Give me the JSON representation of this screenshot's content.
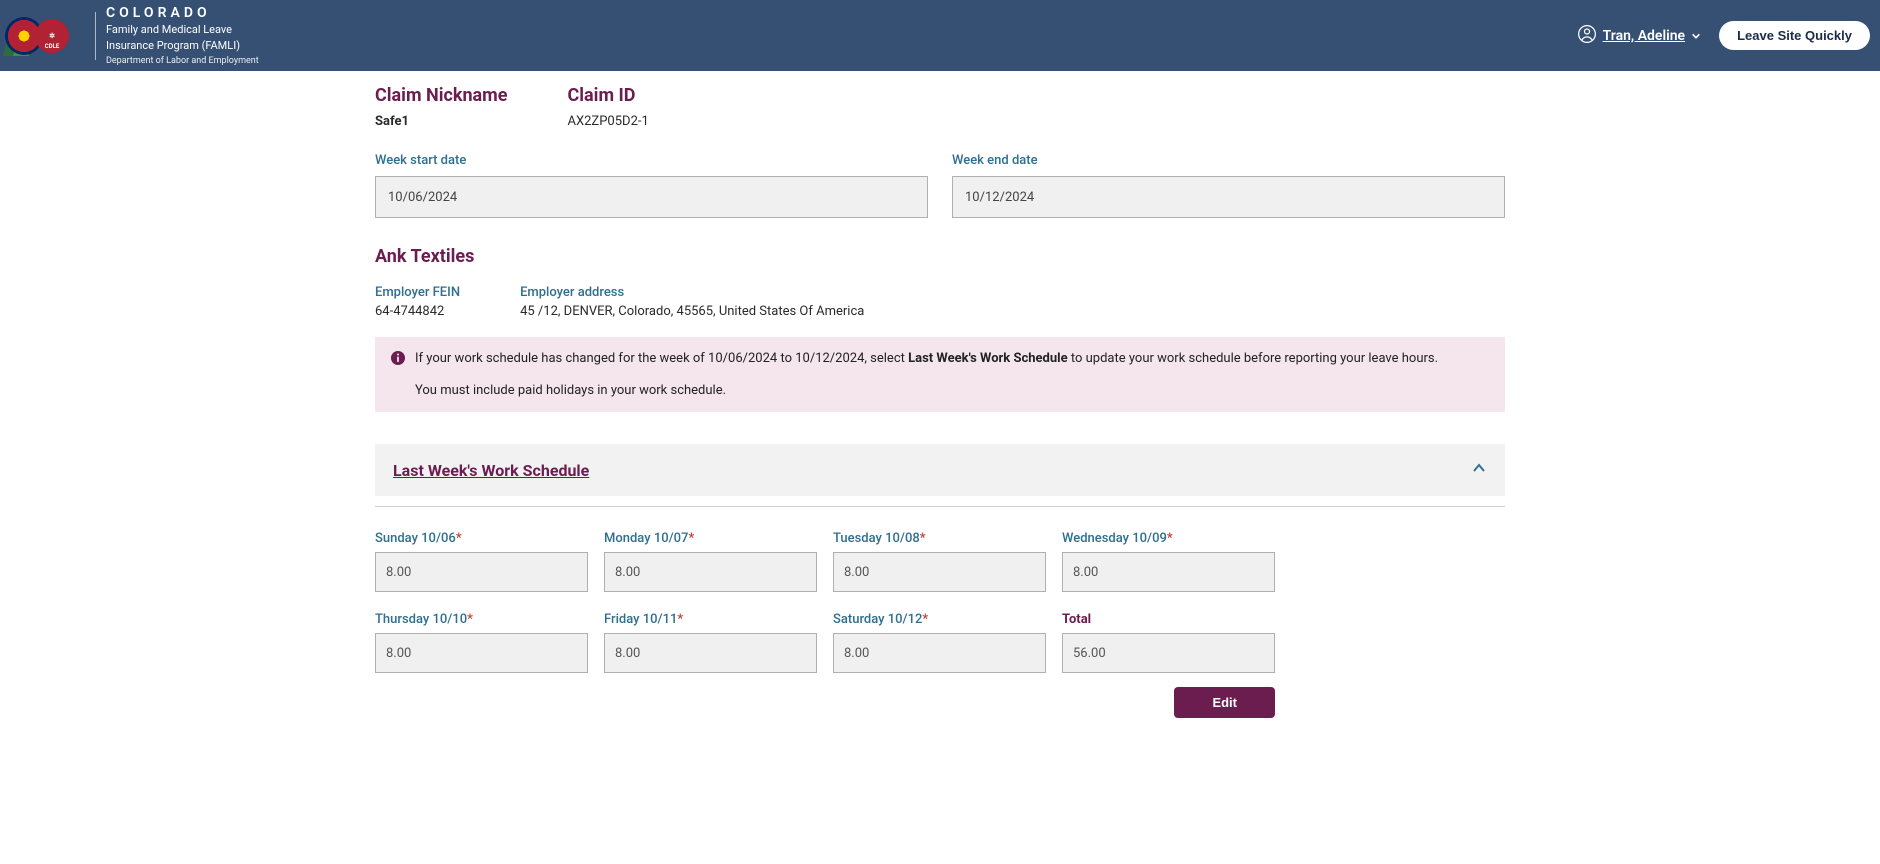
{
  "header": {
    "brand_line1": "COLORADO",
    "brand_line2": "Family and Medical Leave",
    "brand_line3": "Insurance Program (FAMLI)",
    "brand_line4": "Department of Labor and Employment",
    "user_name": "Tran, Adeline",
    "leave_button": "Leave Site Quickly"
  },
  "claim": {
    "nickname_label": "Claim Nickname",
    "nickname_value": "Safe1",
    "id_label": "Claim ID",
    "id_value": "AX2ZP05D2-1"
  },
  "week": {
    "start_label": "Week start date",
    "start_value": "10/06/2024",
    "end_label": "Week end date",
    "end_value": "10/12/2024"
  },
  "employer": {
    "name": "Ank Textiles",
    "fein_label": "Employer FEIN",
    "fein_value": "64-4744842",
    "address_label": "Employer address",
    "address_value": "45 /12, DENVER, Colorado, 45565, United States Of America"
  },
  "banner": {
    "text_before": "If your work schedule has changed for the week of 10/06/2024 to 10/12/2024, select ",
    "bold": "Last Week's Work Schedule",
    "text_after": " to update your work schedule before reporting your leave hours.",
    "para2": "You must include paid holidays in your work schedule."
  },
  "accordion": {
    "title": "Last Week's Work Schedule"
  },
  "schedule": {
    "days": [
      {
        "label": "Sunday 10/06",
        "value": "8.00",
        "required": true
      },
      {
        "label": "Monday 10/07",
        "value": "8.00",
        "required": true
      },
      {
        "label": "Tuesday 10/08",
        "value": "8.00",
        "required": true
      },
      {
        "label": "Wednesday 10/09",
        "value": "8.00",
        "required": true
      },
      {
        "label": "Thursday 10/10",
        "value": "8.00",
        "required": true
      },
      {
        "label": "Friday 10/11",
        "value": "8.00",
        "required": true
      },
      {
        "label": "Saturday 10/12",
        "value": "8.00",
        "required": true
      }
    ],
    "total_label": "Total",
    "total_value": "56.00",
    "edit_label": "Edit"
  }
}
